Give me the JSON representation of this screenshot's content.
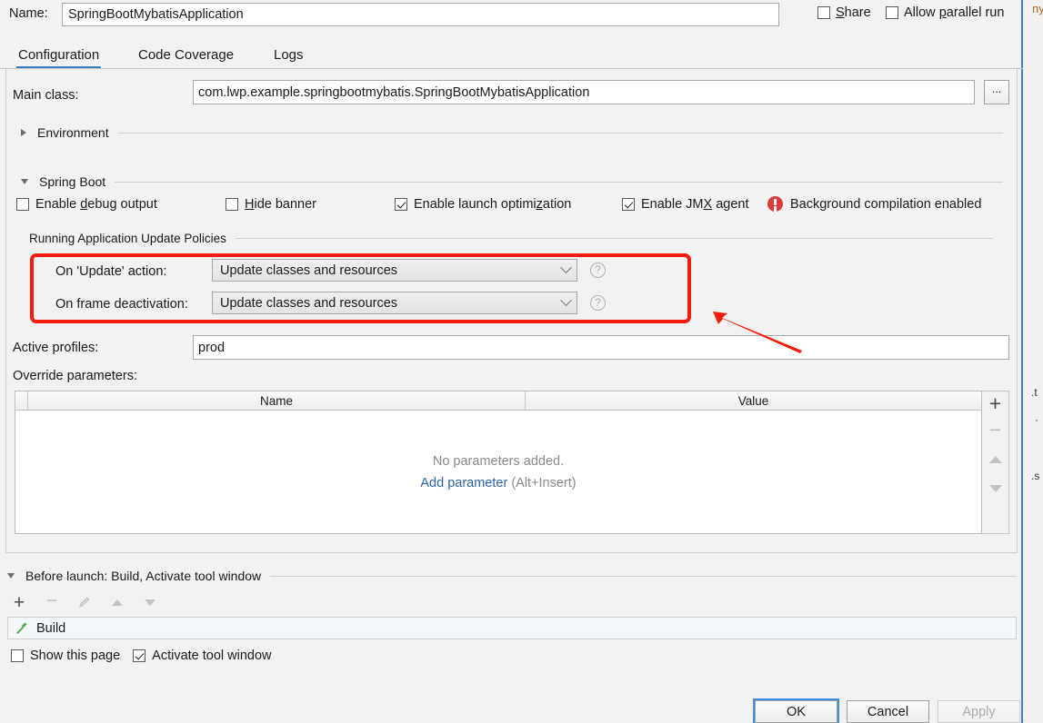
{
  "dialog": {
    "name_label": "Name:",
    "name_value": "SpringBootMybatisApplication",
    "share_label": "Share",
    "parallel_label": "Allow parallel run"
  },
  "tabs": [
    {
      "label": "Configuration",
      "active": true
    },
    {
      "label": "Code Coverage",
      "active": false
    },
    {
      "label": "Logs",
      "active": false
    }
  ],
  "configuration": {
    "main_class_label": "Main class:",
    "main_class_value": "com.lwp.example.springbootmybatis.SpringBootMybatisApplication",
    "browse_label": "...",
    "environment_section": "Environment",
    "spring_boot_section": "Spring Boot",
    "checkboxes": [
      {
        "label": "Enable debug output",
        "checked": false
      },
      {
        "label": "Hide banner",
        "checked": false
      },
      {
        "label": "Enable launch optimization",
        "checked": true
      },
      {
        "label": "Enable JMX agent",
        "checked": true
      }
    ],
    "warning_text": "Background compilation enabled",
    "warning_color": "#dc3c3c",
    "policies": {
      "section_title": "Running Application Update Policies",
      "highlight_color": "#f41d0d",
      "rows": [
        {
          "label": "On 'Update' action:",
          "value": "Update classes and resources",
          "help": "?"
        },
        {
          "label": "On frame deactivation:",
          "value": "Update classes and resources",
          "help": "?"
        }
      ]
    },
    "active_profiles_label": "Active profiles:",
    "active_profiles_value": "prod",
    "override_parameters_label": "Override parameters:",
    "params_table": {
      "columns": [
        "",
        "Name",
        "Value"
      ],
      "rows": [],
      "empty_text": "No parameters added.",
      "add_link": "Add parameter",
      "add_hint": "(Alt+Insert)",
      "link_color": "#2964a8",
      "toolbar": [
        "+",
        "−",
        "up",
        "down"
      ]
    }
  },
  "before_launch": {
    "header": "Before launch: Build, Activate tool window",
    "toolbar": [
      "+",
      "−",
      "edit",
      "up",
      "down"
    ],
    "items": [
      {
        "label": "Build",
        "icon": "hammer-icon"
      }
    ],
    "show_page_label": "Show this page",
    "show_page_checked": false,
    "activate_tool_window_label": "Activate tool window",
    "activate_tool_window_checked": true
  },
  "buttons": {
    "ok": "OK",
    "cancel": "Cancel",
    "apply": "Apply",
    "focus_color": "#3d8fe0"
  },
  "background_window": {
    "top_text": "ny",
    "mid_text": ".t",
    "dot_text": "·",
    "low_text": ".s"
  }
}
